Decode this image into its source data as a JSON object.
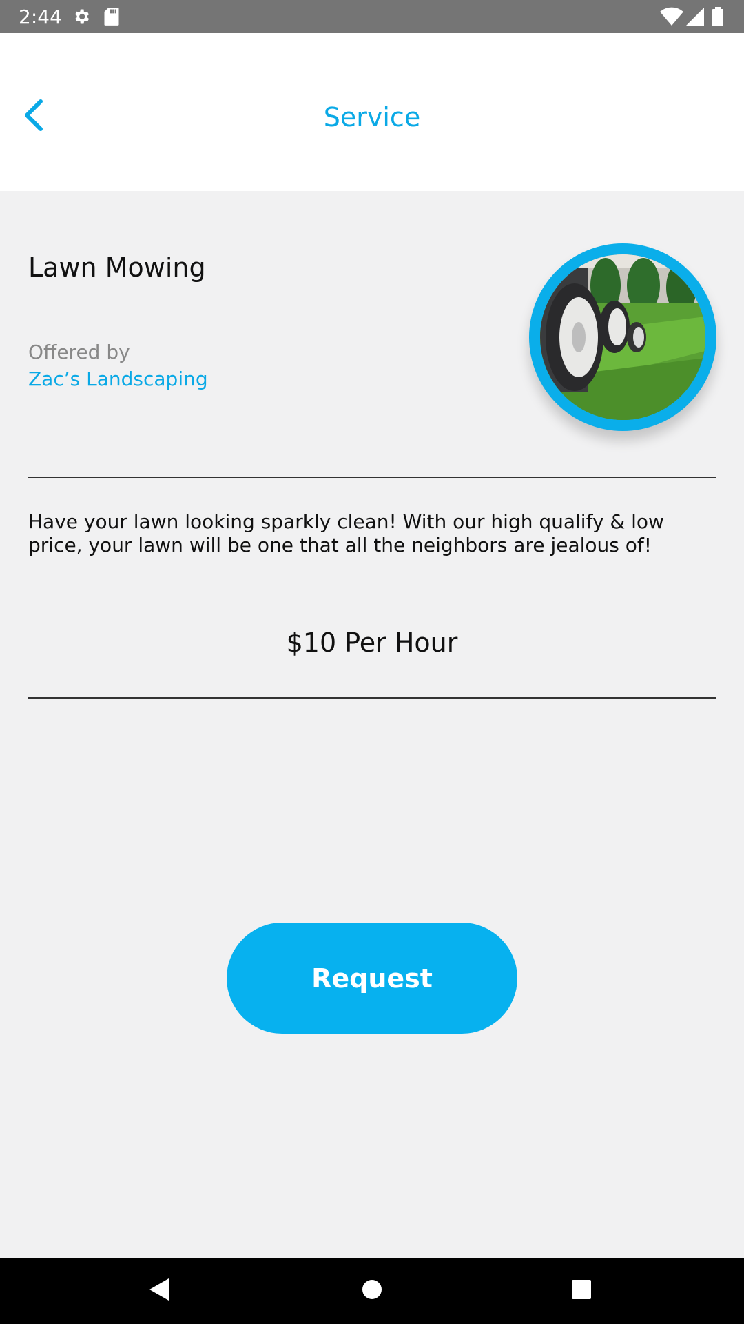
{
  "status_bar": {
    "time": "2:44",
    "left_icons": [
      "gear-icon",
      "sd-card-icon"
    ],
    "right_icons": [
      "wifi-icon",
      "signal-icon",
      "battery-icon"
    ]
  },
  "header": {
    "title": "Service",
    "back_icon": "chevron-left-icon"
  },
  "service": {
    "name": "Lawn Mowing",
    "offered_label": "Offered by",
    "provider": "Zac’s Landscaping",
    "description": "Have your lawn looking sparkly clean! With our high qualify & low price, your lawn will be one that all the neighbors are jealous of!",
    "price": "$10 Per Hour",
    "image_icon": "lawn-mower-photo"
  },
  "actions": {
    "request_label": "Request"
  },
  "nav_bar": {
    "items": [
      "back-triangle-icon",
      "home-circle-icon",
      "recents-square-icon"
    ]
  },
  "colors": {
    "accent": "#0aa9e6",
    "button": "#07b1ef",
    "background": "#f1f1f2",
    "status_bar": "#757575"
  }
}
